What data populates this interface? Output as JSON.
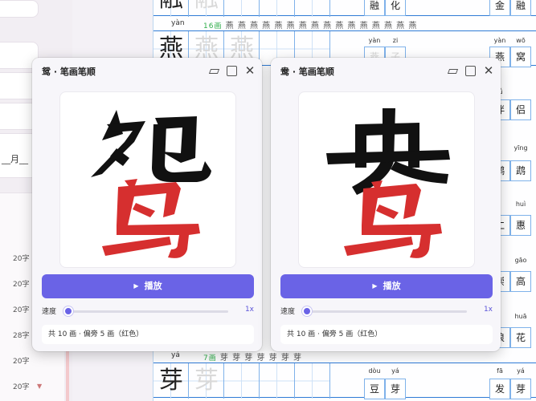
{
  "colors": {
    "accent": "#6a63e6",
    "stroke_done": "#111111",
    "stroke_radical": "#d62f2f",
    "grid_blue": "#2f7bd6"
  },
  "sidebar": {
    "date_text": "__月__",
    "counts": [
      "20字",
      "20字",
      "20字",
      "28字",
      "20字",
      "20字",
      "20字"
    ]
  },
  "worksheet": {
    "rows": [
      {
        "main_char": "融",
        "ghost_chars": [
          "融"
        ],
        "side": [
          "融",
          "化",
          "金",
          "融"
        ]
      },
      {
        "pinyin": "yàn",
        "stroke_count": "16画",
        "stroke_seq": "燕 燕 燕 燕 燕 燕 燕 燕 燕 燕 燕 燕 燕 燕 燕 燕",
        "main_char": "燕",
        "ghost_chars": [
          "燕",
          "燕"
        ],
        "side_pinyin": [
          "yàn",
          "zi",
          "yàn",
          "wō"
        ],
        "side": [
          "燕",
          "子",
          "燕",
          "窝"
        ]
      },
      {
        "side_pinyin": [
          "",
          "",
          "lǚ",
          ""
        ],
        "side": [
          "",
          "",
          "伴",
          "侣"
        ]
      },
      {
        "side_pinyin": [
          "",
          "",
          "yīng",
          ""
        ],
        "side": [
          "",
          "",
          "鹦",
          "鹉"
        ]
      },
      {
        "side_pinyin": [
          "",
          "",
          "huì",
          ""
        ],
        "side": [
          "",
          "",
          "仁",
          "惠"
        ]
      },
      {
        "side_pinyin": [
          "",
          "",
          "gāo",
          ""
        ],
        "side": [
          "",
          "",
          "崇",
          "高"
        ]
      },
      {
        "side_pinyin": [
          "",
          "",
          "huā",
          ""
        ],
        "side": [
          "",
          "",
          "浪",
          "花"
        ]
      },
      {
        "pinyin": "yá",
        "stroke_count": "7画",
        "stroke_seq": "芽 芽 芽 芽 芽 芽 芽",
        "main_char": "芽",
        "ghost_chars": [
          "芽"
        ],
        "side_pinyin": [
          "dòu",
          "yá",
          "fā",
          "yá"
        ],
        "side": [
          "豆",
          "芽",
          "发",
          "芽"
        ]
      }
    ]
  },
  "windows": [
    {
      "title": "鸳 · 笔画笔顺",
      "character": "鸳",
      "play_label": "播放",
      "speed_label": "速度",
      "speed_value": "1x",
      "speed_level": 0.0,
      "info": "共 10 画 · 偏旁 5 画（红色）",
      "icons": [
        "window-minimize-icon",
        "window-maximize-icon",
        "close-icon",
        "play-icon"
      ]
    },
    {
      "title": "鸯 · 笔画笔顺",
      "character": "鸯",
      "play_label": "播放",
      "speed_label": "速度",
      "speed_value": "1x",
      "speed_level": 0.0,
      "info": "共 10 画 · 偏旁 5 画（红色）",
      "icons": [
        "window-minimize-icon",
        "window-maximize-icon",
        "close-icon",
        "play-icon"
      ]
    }
  ]
}
